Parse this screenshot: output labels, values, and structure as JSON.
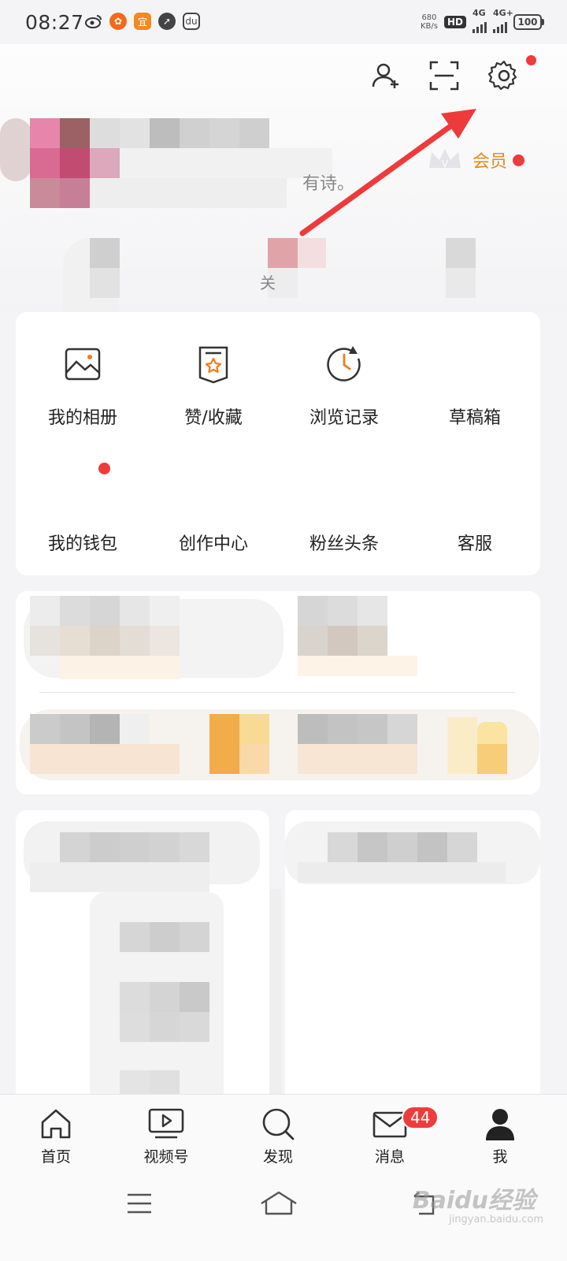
{
  "status_bar": {
    "time": "08:27",
    "net_speed_value": "680",
    "net_speed_unit": "KB/s",
    "hd_label": "HD",
    "signal_1": "4G",
    "signal_2": "4G+",
    "battery": "100"
  },
  "profile": {
    "bio_fragment": "有诗。",
    "vip_label": "会员",
    "stat_fragment": "关"
  },
  "menu": {
    "row1": [
      {
        "label": "我的相册",
        "icon": "photo-album-icon"
      },
      {
        "label": "赞/收藏",
        "icon": "favorite-bookmark-icon"
      },
      {
        "label": "浏览记录",
        "icon": "history-clock-icon"
      },
      {
        "label": "草稿箱",
        "icon": "drafts-icon"
      }
    ],
    "row2": [
      {
        "label": "我的钱包",
        "icon": "wallet-icon"
      },
      {
        "label": "创作中心",
        "icon": "creator-center-icon"
      },
      {
        "label": "粉丝头条",
        "icon": "fans-headline-icon"
      },
      {
        "label": "客服",
        "icon": "customer-service-icon"
      }
    ]
  },
  "bottom_nav": {
    "items": [
      {
        "label": "首页",
        "icon": "home-icon"
      },
      {
        "label": "视频号",
        "icon": "video-channel-icon"
      },
      {
        "label": "发现",
        "icon": "search-discover-icon"
      },
      {
        "label": "消息",
        "icon": "mail-icon",
        "badge": "44"
      },
      {
        "label": "我",
        "icon": "user-profile-icon"
      }
    ]
  },
  "watermark": {
    "brand": "Baidu经验",
    "url": "jingyan.baidu.com"
  },
  "colors": {
    "accent_red": "#ef3b3b",
    "vip_orange": "#e08a1e",
    "clock_orange": "#f07b1c"
  }
}
